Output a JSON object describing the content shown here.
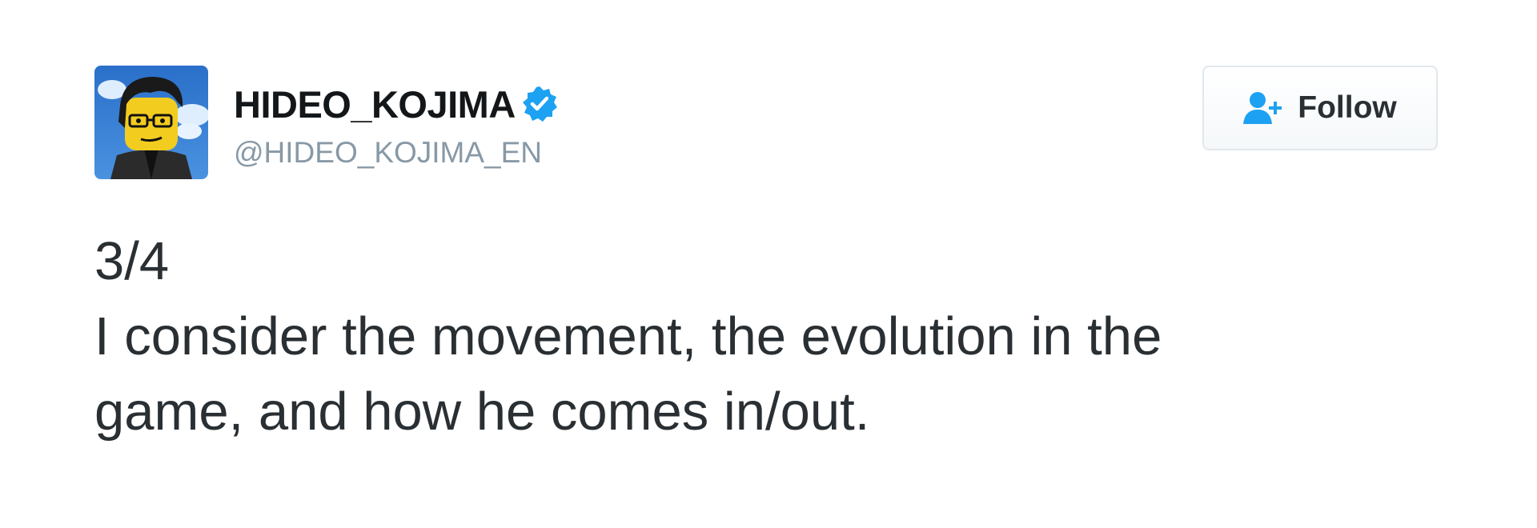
{
  "author": {
    "display_name": "HIDEO_KOJIMA",
    "handle": "@HIDEO_KOJIMA_EN",
    "verified": true
  },
  "follow_button": {
    "label": "Follow",
    "icon": "follow-user-icon"
  },
  "tweet": {
    "lines": [
      "3/4",
      "I consider the movement, the evolution in the",
      "game, and how he comes in/out."
    ]
  },
  "colors": {
    "verified_blue": "#1da1f2",
    "text": "#292f33",
    "muted": "#8899a6"
  }
}
